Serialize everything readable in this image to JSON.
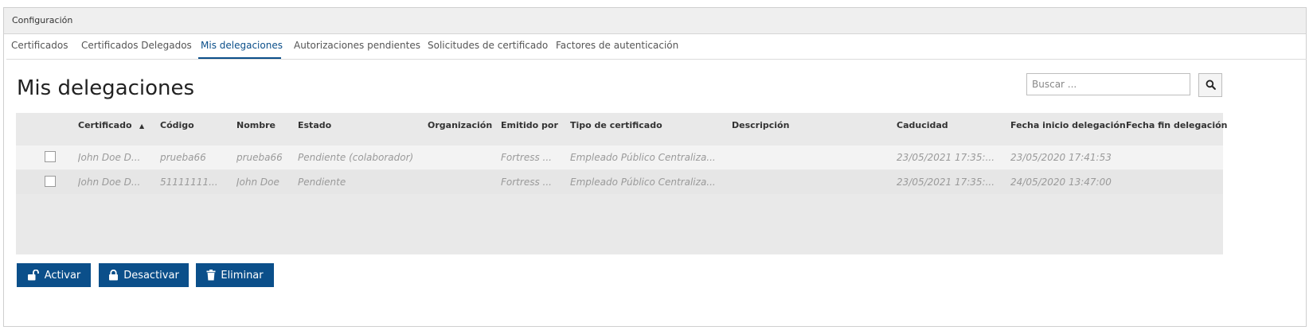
{
  "panel": {
    "title": "Configuración"
  },
  "tabs": [
    {
      "label": "Certificados"
    },
    {
      "label": "Certificados Delegados"
    },
    {
      "label": "Mis delegaciones",
      "active": true
    },
    {
      "label": "Autorizaciones pendientes"
    },
    {
      "label": "Solicitudes de certificado"
    },
    {
      "label": "Factores de autenticación"
    }
  ],
  "page": {
    "title": "Mis delegaciones"
  },
  "search": {
    "placeholder": "Buscar ...",
    "value": "",
    "icon": "search-icon"
  },
  "table": {
    "columns": [
      "Certificado",
      "Código",
      "Nombre",
      "Estado",
      "Organización",
      "Emitido por",
      "Tipo de certificado",
      "Descripción",
      "Caducidad",
      "Fecha inicio delegación",
      "Fecha fin delegación"
    ],
    "sorted_column": "Certificado",
    "sort_direction": "asc",
    "rows": [
      {
        "checked": false,
        "certificado": "John Doe D...",
        "codigo": "prueba66",
        "nombre": "prueba66",
        "estado": "Pendiente (colaborador)",
        "organizacion": "",
        "emitido_por": "Fortress ...",
        "tipo": "Empleado Público Centraliza...",
        "descripcion": "",
        "caducidad": "23/05/2021 17:35:...",
        "fecha_inicio": "23/05/2020 17:41:53",
        "fecha_fin": ""
      },
      {
        "checked": false,
        "certificado": "John Doe D...",
        "codigo": "51111111...",
        "nombre": "John Doe",
        "estado": "Pendiente",
        "organizacion": "",
        "emitido_por": "Fortress ...",
        "tipo": "Empleado Público Centraliza...",
        "descripcion": "",
        "caducidad": "23/05/2021 17:35:...",
        "fecha_inicio": "24/05/2020 13:47:00",
        "fecha_fin": ""
      }
    ]
  },
  "actions": {
    "activate": {
      "label": "Activar",
      "icon": "unlock-icon"
    },
    "deactivate": {
      "label": "Desactivar",
      "icon": "lock-icon"
    },
    "delete": {
      "label": "Eliminar",
      "icon": "trash-icon"
    }
  },
  "colors": {
    "accent": "#0b4f8a",
    "grid_background": "#e9e9e9",
    "row_text": "#9a9a9a"
  }
}
